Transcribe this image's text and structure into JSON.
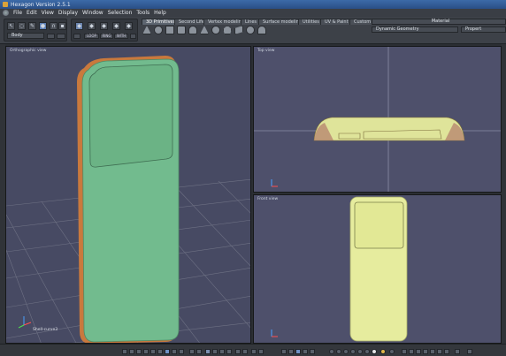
{
  "window": {
    "title": "Hexagon Version 2.5.1",
    "title_bar_color": "#2f5b96"
  },
  "menu": {
    "items": [
      "File",
      "Edit",
      "View",
      "Display",
      "Window",
      "Selection",
      "Tools",
      "Help"
    ]
  },
  "toolbar": {
    "tabs": [
      "3D Primitives",
      "Second Life",
      "Vertex modeling",
      "Lines",
      "Surface modeling",
      "Utilities",
      "UV & Paint",
      "Custom"
    ],
    "active_tab": "3D Primitives",
    "view_dropdown": "Body",
    "right_panel_title": "Material",
    "dynamic_geometry": "Dynamic Geometry",
    "properties_label": "Propert",
    "mode_buttons": [
      "LOOP",
      "RING",
      "WITH"
    ]
  },
  "viewports": {
    "perspective": {
      "label": "Orthographic view",
      "object_label": "Shell-curve3"
    },
    "top": {
      "label": "Top view"
    },
    "front": {
      "label": "Front view"
    }
  },
  "colors": {
    "viewport_bg": "#4e506b",
    "object_green": "#6fb88a",
    "object_yellow": "#e5ec9c",
    "accent": "#d07b3c"
  }
}
